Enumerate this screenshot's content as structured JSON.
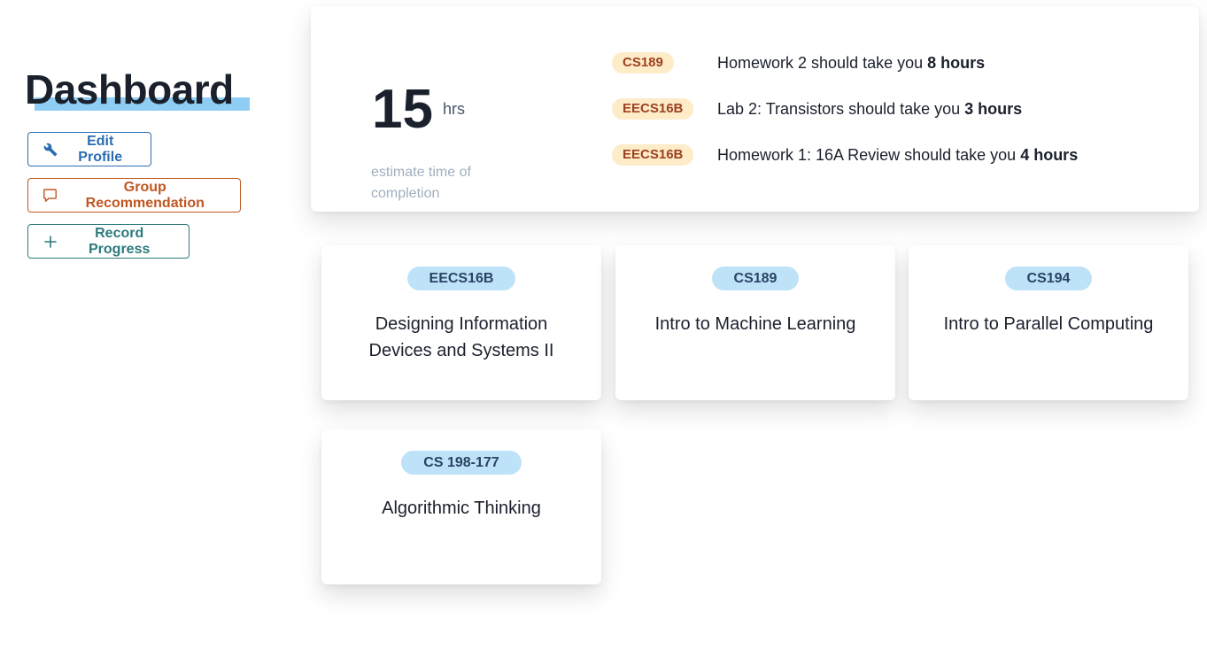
{
  "sidebar": {
    "title": "Dashboard",
    "buttons": {
      "edit_profile": "Edit Profile",
      "group_recommendation": "Group Recommendation",
      "record_progress": "Record Progress"
    }
  },
  "summary": {
    "hours": "15",
    "unit": "hrs",
    "label": "estimate time of completion",
    "tasks": [
      {
        "course": "CS189",
        "text": "Homework 2 should take you ",
        "hours": "8 hours"
      },
      {
        "course": "EECS16B",
        "text": "Lab 2: Transistors should take you ",
        "hours": "3 hours"
      },
      {
        "course": "EECS16B",
        "text": "Homework 1: 16A Review should take you ",
        "hours": "4 hours"
      }
    ]
  },
  "courses": [
    {
      "code": "EECS16B",
      "name": "Designing Information Devices and Systems II"
    },
    {
      "code": "CS189",
      "name": "Intro to Machine Learning"
    },
    {
      "code": "CS194",
      "name": "Intro to Parallel Computing"
    },
    {
      "code": "CS 198-177",
      "name": "Algorithmic Thinking"
    }
  ],
  "colors": {
    "title_underline": "#90cdf4",
    "edit_profile": "#2b6cb0",
    "group_recommendation": "#c05621",
    "record_progress": "#2c7a7b",
    "task_badge_bg": "#feebc8",
    "course_badge_bg": "#bee3f8"
  },
  "icons": {
    "edit_profile": "wrench-icon",
    "group_recommendation": "chat-bubble-icon",
    "record_progress": "plus-icon"
  }
}
